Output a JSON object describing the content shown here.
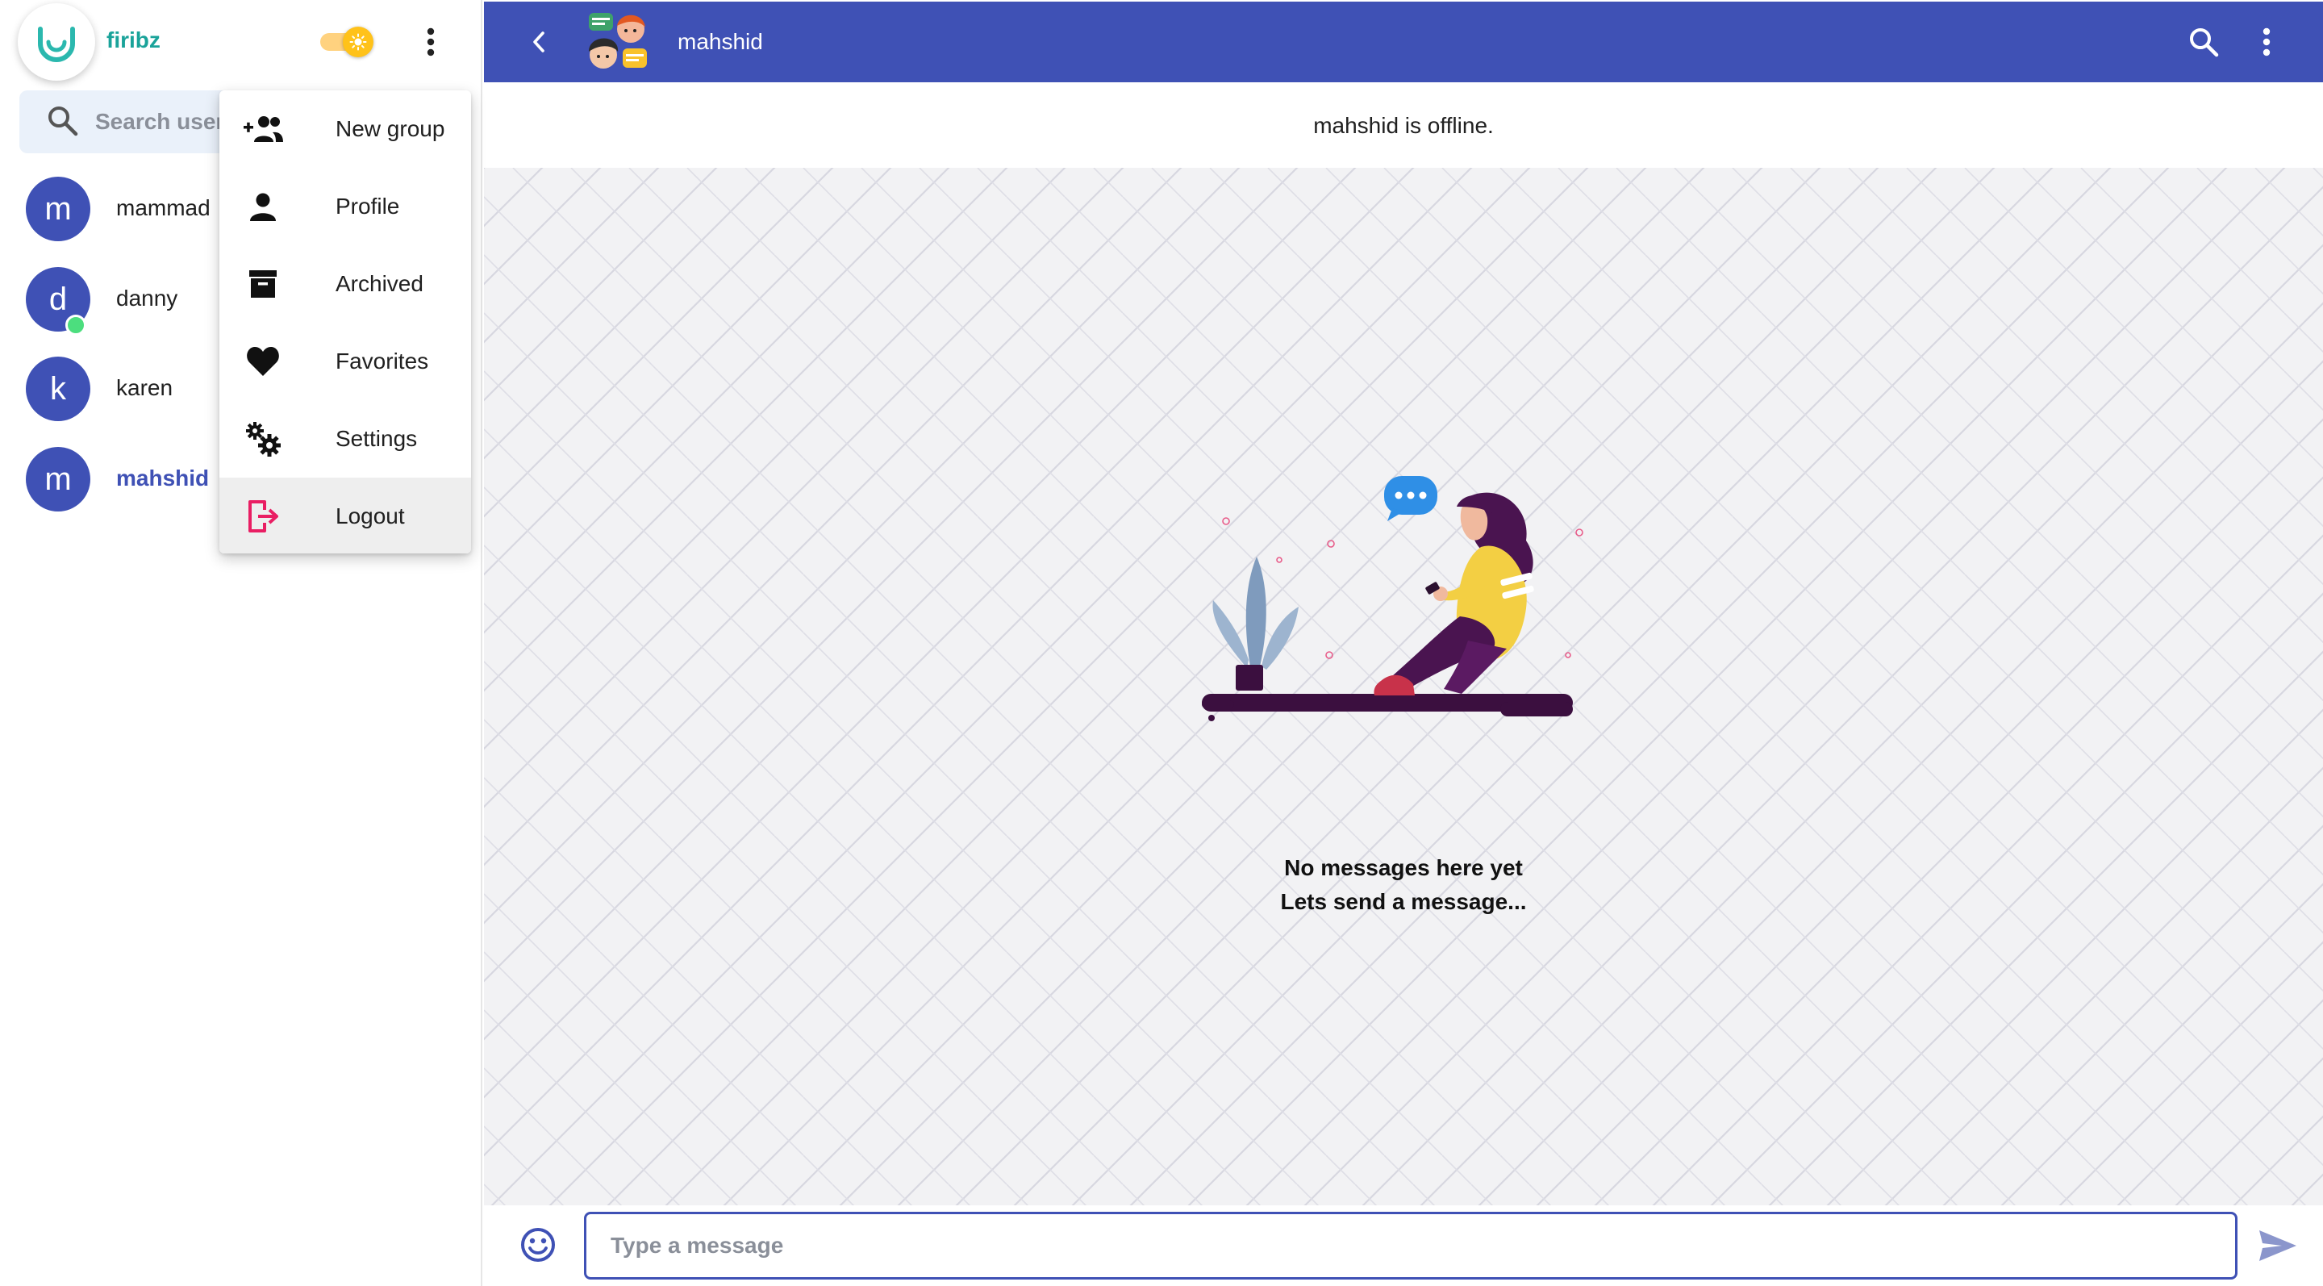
{
  "app": {
    "brand_name": "firibz",
    "theme_mode": "light"
  },
  "sidebar": {
    "search_placeholder": "Search users",
    "contacts": [
      {
        "initial": "m",
        "name": "mammad",
        "online": false,
        "active": false
      },
      {
        "initial": "d",
        "name": "danny",
        "online": true,
        "active": false
      },
      {
        "initial": "k",
        "name": "karen",
        "online": false,
        "active": false
      },
      {
        "initial": "m",
        "name": "mahshid",
        "online": false,
        "active": true
      }
    ]
  },
  "menu": {
    "items": [
      {
        "label": "New group",
        "icon": "group-add-icon"
      },
      {
        "label": "Profile",
        "icon": "person-icon"
      },
      {
        "label": "Archived",
        "icon": "archive-icon"
      },
      {
        "label": "Favorites",
        "icon": "heart-icon"
      },
      {
        "label": "Settings",
        "icon": "gears-icon"
      },
      {
        "label": "Logout",
        "icon": "logout-icon",
        "highlighted": true
      }
    ]
  },
  "chat": {
    "title": "mahshid",
    "status": "mahshid is offline.",
    "empty_title": "No messages here yet",
    "empty_subtitle": "Lets send a message...",
    "input_placeholder": "Type a message"
  },
  "colors": {
    "primary": "#3f51b5",
    "brand": "#1aa39a",
    "online": "#4cde7e",
    "logout_accent": "#e91e63",
    "toggle": "#ffc21a"
  }
}
